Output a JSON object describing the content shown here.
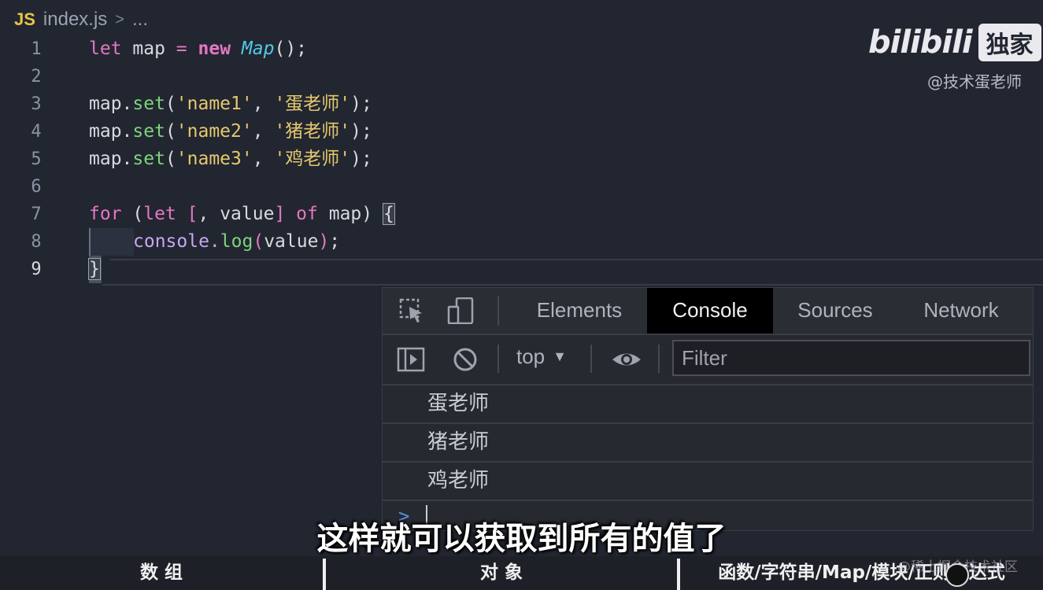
{
  "breadcrumb": {
    "lang": "JS",
    "file": "index.js",
    "sep": ">",
    "more": "..."
  },
  "branding": {
    "brand": "bilibili",
    "badge": "独家",
    "watermark": "@技术蛋老师"
  },
  "editor": {
    "line_numbers": [
      "1",
      "2",
      "3",
      "4",
      "5",
      "6",
      "7",
      "8",
      "9"
    ],
    "lines": {
      "l1": {
        "kw_let": "let",
        "var": " map ",
        "eq": "=",
        "kw_new": "new",
        "cls": "Map",
        "tail": "();"
      },
      "l3": {
        "obj": "map.",
        "fn": "set",
        "p1": "(",
        "s1": "'name1'",
        "c": ", ",
        "s2": "'蛋老师'",
        "end": ");"
      },
      "l4": {
        "obj": "map.",
        "fn": "set",
        "p1": "(",
        "s1": "'name2'",
        "c": ", ",
        "s2": "'猪老师'",
        "end": ");"
      },
      "l5": {
        "obj": "map.",
        "fn": "set",
        "p1": "(",
        "s1": "'name3'",
        "c": ", ",
        "s2": "'鸡老师'",
        "end": ");"
      },
      "l7": {
        "kw_for": "for",
        "a": " (",
        "kw_let": "let",
        "b": " ",
        "lb": "[",
        "c": ", value",
        "rb": "]",
        "d": " ",
        "kw_of": "of",
        "e": " map) ",
        "brace": "{"
      },
      "l8": {
        "obj": "console.",
        "fn": "log",
        "lp": "(",
        "arg": "value",
        "rp": ")",
        "semi": ";"
      },
      "l9": {
        "brace": "}"
      }
    }
  },
  "devtools": {
    "tabs": [
      "Elements",
      "Console",
      "Sources",
      "Network"
    ],
    "active_tab": "Console",
    "context": "top",
    "filter_placeholder": "Filter",
    "logs": [
      "蛋老师",
      "猪老师",
      "鸡老师"
    ],
    "prompt": ">"
  },
  "subtitle": "这样就可以获取到所有的值了",
  "chapters": [
    "数 组",
    "对 象",
    "函数/字符串/Map/模块/正则表达式"
  ],
  "corner_watermark": "@稀土掘金技术社区"
}
